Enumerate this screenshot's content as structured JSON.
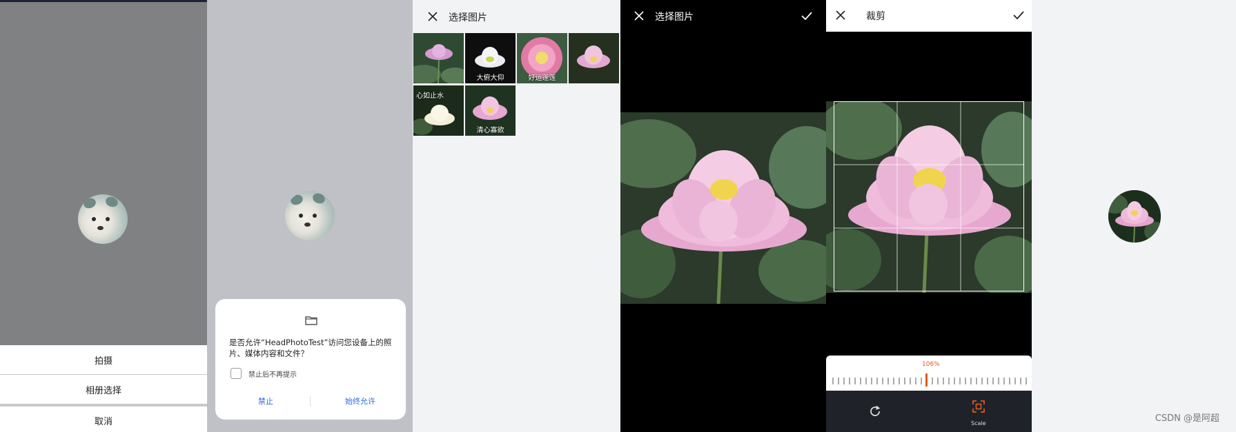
{
  "screen1": {
    "sheet": {
      "take_photo": "拍摄",
      "choose_from_album": "相册选择",
      "cancel": "取消"
    }
  },
  "screen2": {
    "permission_dialog": {
      "message": "是否允许“HeadPhotoTest”访问您设备上的照片、媒体内容和文件？",
      "checkbox_label": "禁止后不再提示",
      "deny": "禁止",
      "allow": "始终允许"
    }
  },
  "screen3": {
    "title": "选择图片",
    "photos": [
      {
        "caption": ""
      },
      {
        "caption": "大俯大仰"
      },
      {
        "caption": "好运莲莲"
      },
      {
        "caption": ""
      },
      {
        "caption": "心如止水"
      },
      {
        "caption": "清心寡欲"
      }
    ]
  },
  "screen4": {
    "title": "选择图片"
  },
  "screen5": {
    "title": "裁剪",
    "zoom_percent": "106%",
    "scale_label": "Scale"
  },
  "watermark": "CSDN @是阿超",
  "colors": {
    "accent": "#e05a1a",
    "link": "#2f6be0",
    "dark_toolbar": "#1f2329"
  }
}
